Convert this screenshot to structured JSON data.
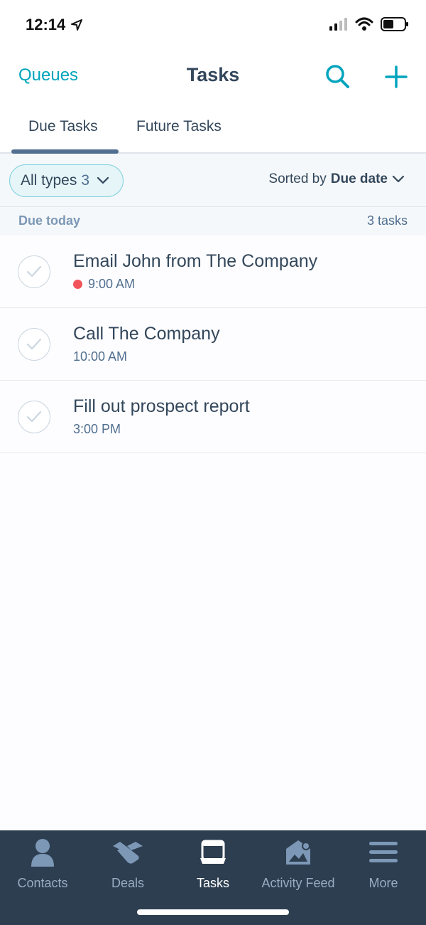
{
  "status_bar": {
    "time": "12:14"
  },
  "header": {
    "left_link": "Queues",
    "title": "Tasks"
  },
  "tabs": [
    {
      "label": "Due Tasks",
      "active": true
    },
    {
      "label": "Future Tasks",
      "active": false
    }
  ],
  "filter": {
    "types_label": "All types",
    "types_count": "3",
    "sort_prefix": "Sorted by",
    "sort_value": "Due date"
  },
  "section": {
    "title": "Due today",
    "count": "3 tasks"
  },
  "tasks": [
    {
      "title": "Email John from The Company",
      "time": "9:00 AM",
      "overdue": true
    },
    {
      "title": "Call The Company",
      "time": "10:00 AM",
      "overdue": false
    },
    {
      "title": "Fill out prospect report",
      "time": "3:00 PM",
      "overdue": false
    }
  ],
  "nav": [
    {
      "label": "Contacts",
      "icon": "person-icon",
      "active": false
    },
    {
      "label": "Deals",
      "icon": "handshake-icon",
      "active": false
    },
    {
      "label": "Tasks",
      "icon": "tasks-icon",
      "active": true
    },
    {
      "label": "Activity Feed",
      "icon": "activity-feed-icon",
      "active": false
    },
    {
      "label": "More",
      "icon": "menu-icon",
      "active": false
    }
  ],
  "colors": {
    "accent": "#00a4bd",
    "text": "#33475b",
    "nav_bg": "#2d3e50",
    "overdue": "#f2545b",
    "tab_indicator": "#516f90"
  }
}
